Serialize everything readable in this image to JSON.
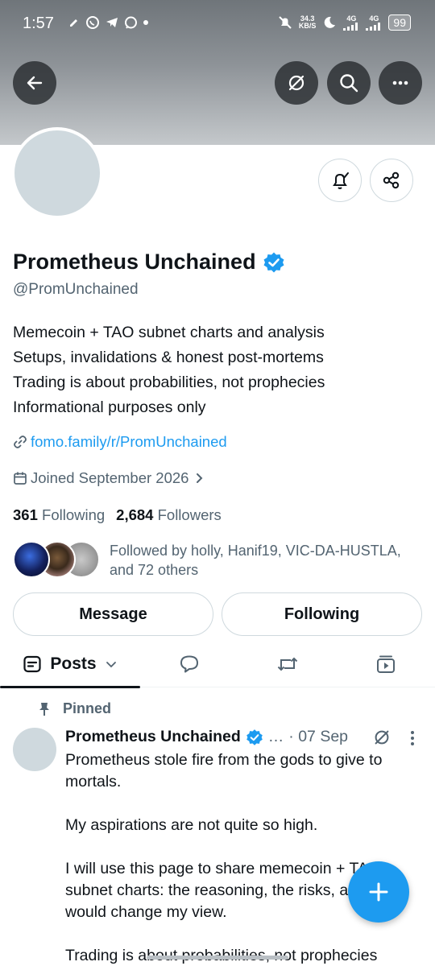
{
  "status_bar": {
    "time": "1:57",
    "net_speed": "34.3\nKB/S",
    "net_speed_top": "34.3",
    "net_speed_bottom": "KB/S",
    "signal1": "4G",
    "signal2": "4G",
    "battery": "99"
  },
  "header_icons": {
    "back": "arrow-left-icon",
    "grok": "grok-icon",
    "search": "search-icon",
    "more": "more-icon"
  },
  "profile": {
    "name": "Prometheus Unchained",
    "verified": true,
    "handle": "@PromUnchained",
    "bio": [
      "Memecoin + TAO subnet charts and analysis",
      "Setups, invalidations & honest post-mortems",
      "Trading is about probabilities, not prophecies",
      "Informational purposes only"
    ],
    "link": "fomo.family/r/PromUnchained",
    "joined": "Joined September 2026",
    "following_count": "361",
    "following_label": "Following",
    "followers_count": "2,684",
    "followers_label": "Followers",
    "followed_by": "Followed by holly, Hanif19, VIC-DA-HUSTLA, and 72 others"
  },
  "actions": {
    "message": "Message",
    "following": "Following"
  },
  "tabs": {
    "posts": "Posts"
  },
  "pinned_post": {
    "pinned_label": "Pinned",
    "author": "Prometheus Unchained",
    "ellipsis": "…",
    "date": "· 07 Sep",
    "paragraphs": [
      "Prometheus stole fire from the gods to give to mortals.",
      "My aspirations are not quite so high.",
      "I will use this page to share memecoin + TAO subnet charts: the reasoning, the risks, and what would change my view.",
      "Trading is about probabilities, not prophecies"
    ]
  },
  "colors": {
    "accent": "#1d9bf0",
    "text": "#0f1419",
    "muted": "#536471",
    "border": "#cfd9de"
  }
}
